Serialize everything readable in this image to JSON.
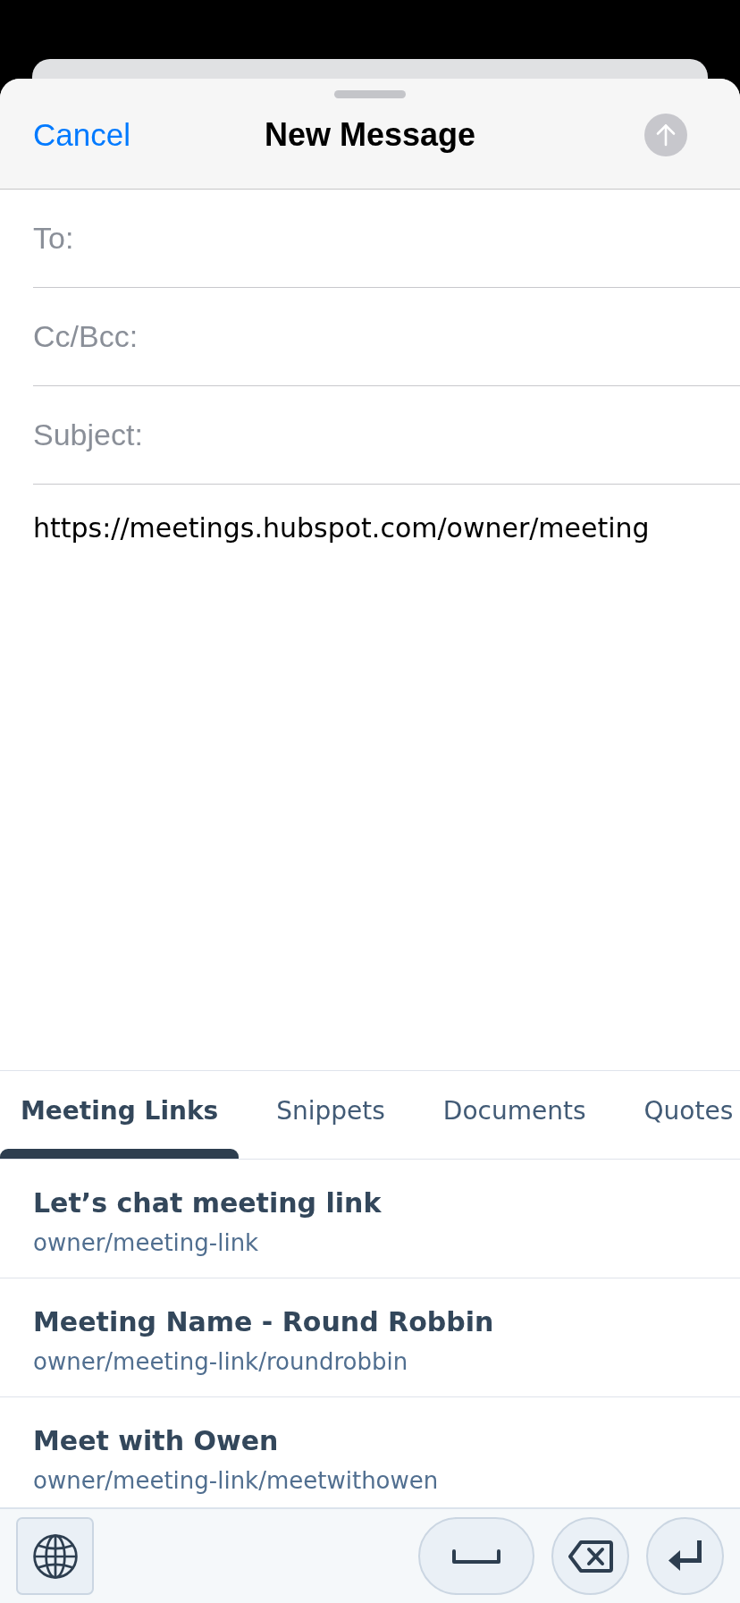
{
  "sheet": {
    "cancel": "Cancel",
    "title": "New Message"
  },
  "send_button": {
    "disabled": true
  },
  "fields": [
    {
      "label": "To:"
    },
    {
      "label": "Cc/Bcc:"
    },
    {
      "label": "Subject:"
    }
  ],
  "body": "https://meetings.hubspot.com/owner/meeting",
  "tabs": [
    {
      "label": "Meeting Links",
      "selected": true
    },
    {
      "label": "Snippets",
      "selected": false
    },
    {
      "label": "Documents",
      "selected": false
    },
    {
      "label": "Quotes",
      "selected": false
    }
  ],
  "meeting_links": [
    {
      "name": "Let’s chat meeting link",
      "path": "owner/meeting-link"
    },
    {
      "name": "Meeting Name - Round Robbin",
      "path": "owner/meeting-link/roundrobbin"
    },
    {
      "name": "Meet with Owen",
      "path": "owner/meeting-link/meetwithowen"
    }
  ]
}
